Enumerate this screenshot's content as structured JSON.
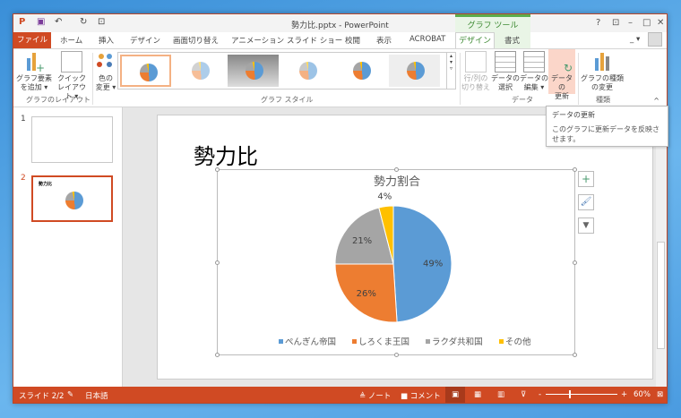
{
  "window": {
    "title": "勢力比.pptx - PowerPoint",
    "context_tab_group": "グラフ ツール",
    "help": "?",
    "minimize": "–",
    "maximize": "□",
    "close": "✕"
  },
  "tabs": [
    "ファイル",
    "ホーム",
    "挿入",
    "デザイン",
    "画面切り替え",
    "アニメーション",
    "スライド ショー",
    "校閲",
    "表示",
    "ACROBAT",
    "デザイン",
    "書式"
  ],
  "ribbon": {
    "layout_group": {
      "label": "グラフのレイアウト",
      "buttons": [
        [
          "グラフ要素",
          "を追加 ▾"
        ],
        [
          "クイック",
          "レイアウト ▾"
        ]
      ]
    },
    "style_group": {
      "label": "グラフ スタイル",
      "color_button": [
        "色の",
        "変更 ▾"
      ]
    },
    "data_group": {
      "label": "データ",
      "buttons": [
        [
          "行/列の",
          "切り替え"
        ],
        [
          "データの",
          "選択"
        ],
        [
          "データの",
          "編集 ▾"
        ],
        [
          "データの",
          "更新"
        ]
      ]
    },
    "type_group": {
      "label": "種類",
      "buttons": [
        [
          "グラフの種類",
          "の変更"
        ]
      ]
    }
  },
  "tooltip": {
    "title": "データの更新",
    "body": "このグラフに更新データを反映させます。"
  },
  "slides": [
    {
      "number": "1"
    },
    {
      "number": "2",
      "thumb_title": "勢力比"
    }
  ],
  "slide": {
    "title": "勢力比"
  },
  "chart_data": {
    "type": "pie",
    "title": "勢力割合",
    "categories": [
      "ぺんぎん帝国",
      "しろくま王国",
      "ラクダ共和国",
      "その他"
    ],
    "values": [
      49,
      26,
      21,
      4
    ],
    "labels": [
      "49%",
      "26%",
      "21%",
      "4%"
    ],
    "colors": [
      "#5b9bd5",
      "#ed7d31",
      "#a5a5a5",
      "#ffc000"
    ],
    "legend": "bottom"
  },
  "chart_buttons": {
    "add": "+",
    "style": "🖌",
    "filter": "▼"
  },
  "status": {
    "slide": "スライド 2/2",
    "language": "日本語",
    "notes": "ノート",
    "comments": "コメント",
    "zoom": "60%"
  }
}
